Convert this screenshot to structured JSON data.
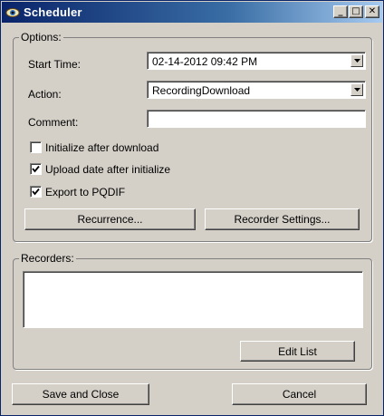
{
  "window": {
    "title": "Scheduler",
    "icon": "scheduler-eye-icon",
    "controls": {
      "minimize": "_",
      "maximize": "□",
      "close": "✕"
    }
  },
  "options": {
    "group_label": "Options:",
    "start_time": {
      "label": "Start Time:",
      "value": "02-14-2012 09:42 PM"
    },
    "action": {
      "label": "Action:",
      "value": "RecordingDownload"
    },
    "comment": {
      "label": "Comment:",
      "value": ""
    },
    "checkboxes": [
      {
        "label": "Initialize after download",
        "checked": false
      },
      {
        "label": "Upload date after initialize",
        "checked": true
      },
      {
        "label": "Export to PQDIF",
        "checked": true
      }
    ],
    "recurrence_button": "Recurrence...",
    "recorder_settings_button": "Recorder Settings..."
  },
  "recorders": {
    "group_label": "Recorders:",
    "items": [],
    "edit_list_button": "Edit List"
  },
  "footer": {
    "save_button": "Save and Close",
    "cancel_button": "Cancel"
  }
}
